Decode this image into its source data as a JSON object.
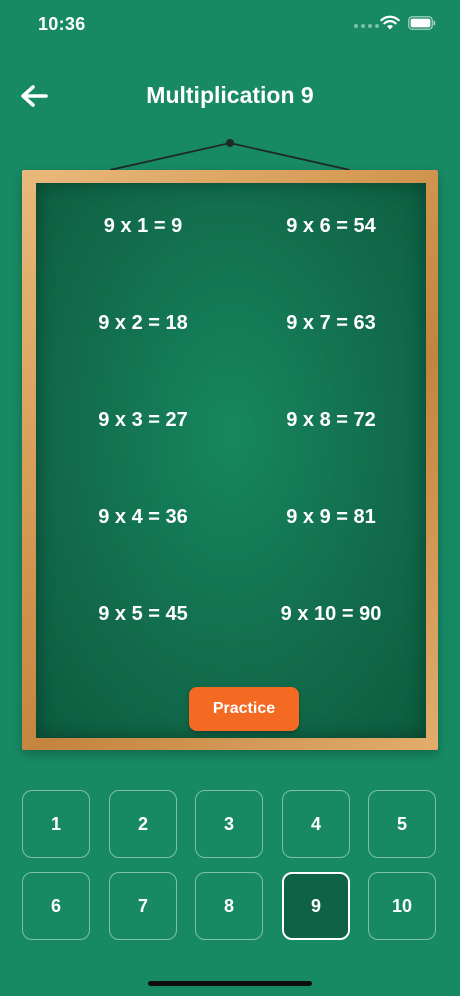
{
  "status_bar": {
    "time": "10:36",
    "icons": [
      "signal-dots-icon",
      "wifi-icon",
      "battery-icon"
    ]
  },
  "header": {
    "back_icon": "arrow-left-icon",
    "title": "Multiplication 9"
  },
  "board": {
    "equations": [
      "9 x 1 = 9",
      "9 x 2 = 18",
      "9 x 3 = 27",
      "9 x 4 = 36",
      "9 x 5 = 45",
      "9 x 6 = 54",
      "9 x 7 = 63",
      "9 x 8 = 72",
      "9 x 9 = 81",
      "9 x 10 = 90"
    ],
    "practice_label": "Practice"
  },
  "number_selector": {
    "options": [
      "1",
      "2",
      "3",
      "4",
      "5",
      "6",
      "7",
      "8",
      "9",
      "10"
    ],
    "selected": "9"
  },
  "colors": {
    "background": "#178a64",
    "board": "#126d4d",
    "frame": "#d59a55",
    "practice_button": "#f56a23",
    "selected_number": "#0f6246"
  }
}
